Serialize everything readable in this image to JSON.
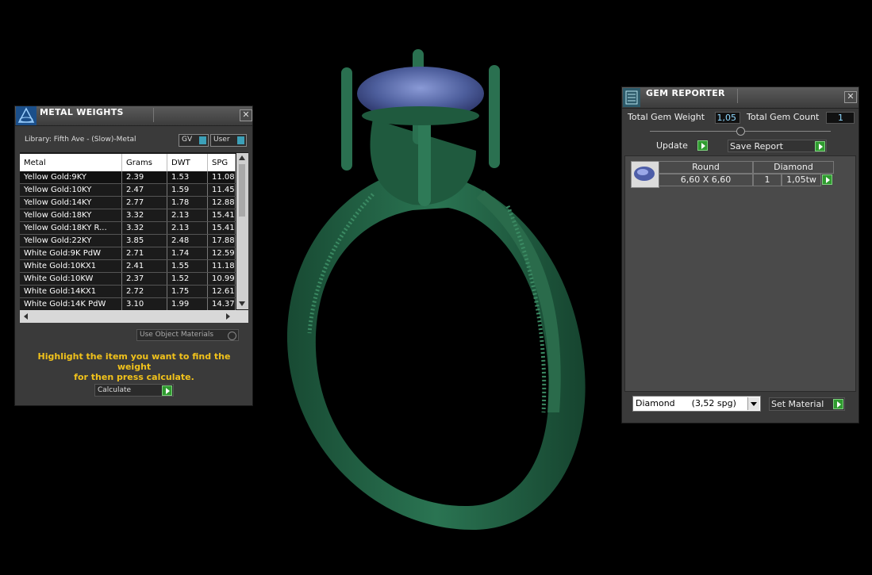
{
  "metal_weights": {
    "title": "METAL WEIGHTS",
    "library_label": "Library: Fifth Ave - (Slow)-Metal",
    "gv_label": "GV",
    "user_label": "User",
    "columns": [
      "Metal",
      "Grams",
      "DWT",
      "SPG"
    ],
    "rows": [
      [
        "Yellow Gold:9KY",
        "2.39",
        "1.53",
        "11.08"
      ],
      [
        "Yellow Gold:10KY",
        "2.47",
        "1.59",
        "11.45"
      ],
      [
        "Yellow Gold:14KY",
        "2.77",
        "1.78",
        "12.88"
      ],
      [
        "Yellow Gold:18KY",
        "3.32",
        "2.13",
        "15.41"
      ],
      [
        "Yellow Gold:18KY R...",
        "3.32",
        "2.13",
        "15.41"
      ],
      [
        "Yellow Gold:22KY",
        "3.85",
        "2.48",
        "17.88"
      ],
      [
        "White Gold:9K PdW",
        "2.71",
        "1.74",
        "12.59"
      ],
      [
        "White Gold:10KX1",
        "2.41",
        "1.55",
        "11.18"
      ],
      [
        "White Gold:10KW",
        "2.37",
        "1.52",
        "10.99"
      ],
      [
        "White Gold:14KX1",
        "2.72",
        "1.75",
        "12.61"
      ],
      [
        "White Gold:14K PdW",
        "3.10",
        "1.99",
        "14.37"
      ]
    ],
    "use_object_materials_label": "Use Object Materials",
    "hint_line1": "Highlight the item you want to find the weight",
    "hint_line2": "for then press calculate.",
    "calculate_label": "Calculate",
    "close_glyph": "✕"
  },
  "gem_reporter": {
    "title": "GEM REPORTER",
    "total_gem_weight_label": "Total Gem Weight",
    "total_gem_weight_value": "1,05",
    "total_gem_count_label": "Total Gem Count",
    "total_gem_count_value": "1",
    "update_label": "Update",
    "save_report_label": "Save Report",
    "gem_row": {
      "shape": "Round",
      "material": "Diamond",
      "size": "6,60 X 6,60",
      "count": "1",
      "weight": "1,05tw"
    },
    "material_select_value": "Diamond      (3,52 spg)",
    "set_material_label": "Set Material",
    "close_glyph": "✕"
  },
  "colors": {
    "ring": "#1f5a3e",
    "gem": "#5a6fb0",
    "accent_green": "#2f9b2f",
    "hint_yellow": "#f1c21b"
  }
}
